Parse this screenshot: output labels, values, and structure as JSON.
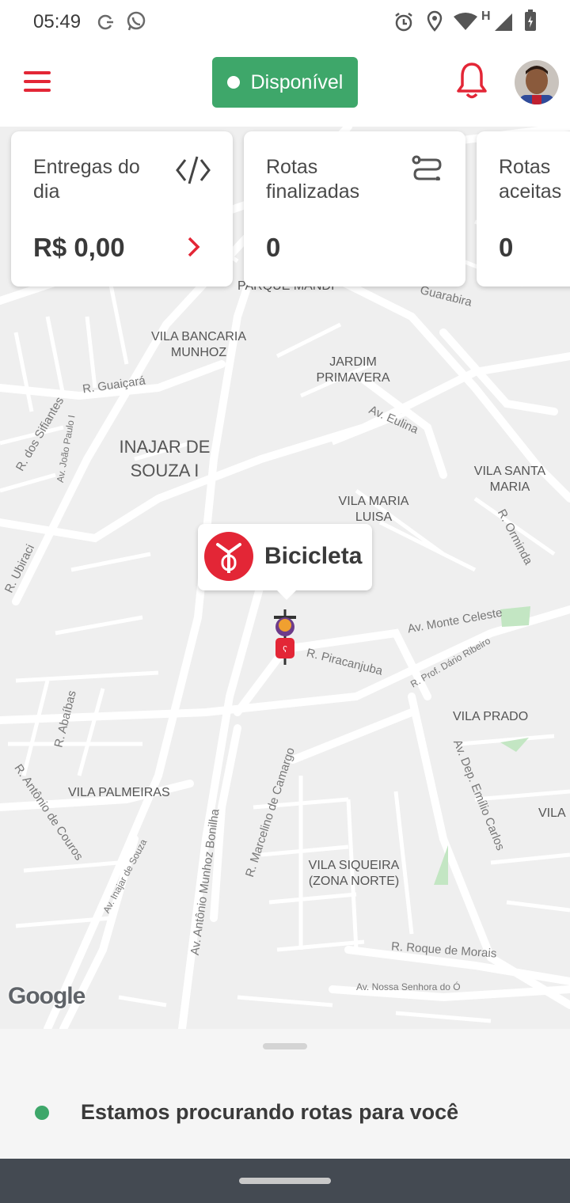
{
  "status_bar": {
    "time": "05:49",
    "network_type": "H",
    "icons_left": [
      "sync-icon",
      "whatsapp-icon"
    ],
    "icons_right": [
      "alarm-icon",
      "location-icon",
      "wifi-icon",
      "signal-icon",
      "battery-icon"
    ]
  },
  "header": {
    "menu_icon": "hamburger-icon",
    "status_label": "Disponível",
    "bell_icon": "bell-icon"
  },
  "cards": [
    {
      "title": "Entregas do dia",
      "value": "R$ 0,00",
      "icon": "slash-code-icon"
    },
    {
      "title": "Rotas finalizadas",
      "value": "0",
      "icon": "route-icon"
    },
    {
      "title": "Rotas aceitas",
      "value": "0"
    }
  ],
  "map": {
    "neighborhoods": [
      "PARQUE MANDI",
      "VILA BANCARIA MUNHOZ",
      "JARDIM PRIMAVERA",
      "INAJAR DE SOUZA I",
      "VILA SANTA MARIA",
      "VILA MARIA LUISA",
      "VILA PRADO",
      "VILA PALMEIRAS",
      "VILA",
      "VILA SIQUEIRA (ZONA NORTE)"
    ],
    "streets": [
      "R. Guaiçará",
      "R. dos Sifiantes",
      "Av. João Paulo I",
      "Av. Eulina",
      "Guarabira",
      "R. Orminda",
      "R. Ubiraci",
      "Av. Monte Celeste",
      "R. Piracanjuba",
      "R. Prof. Dário Ribeiro",
      "R. Abaíbas",
      "Av. Dep. Emílio Carlos",
      "R. Antônio de Couros",
      "Av. Inajar de Souza",
      "Av. Antônio Munhoz Bonilha",
      "R. Marcelino de Camargo",
      "R. Roque de Morais",
      "Av. Nossa Senhora do Ó"
    ],
    "vehicle_label": "Bicicleta",
    "attribution": "Google"
  },
  "bottom_sheet": {
    "message": "Estamos procurando rotas para você"
  },
  "colors": {
    "accent_red": "#e32636",
    "status_green": "#3ea76a",
    "nav_bar": "#444a52"
  }
}
